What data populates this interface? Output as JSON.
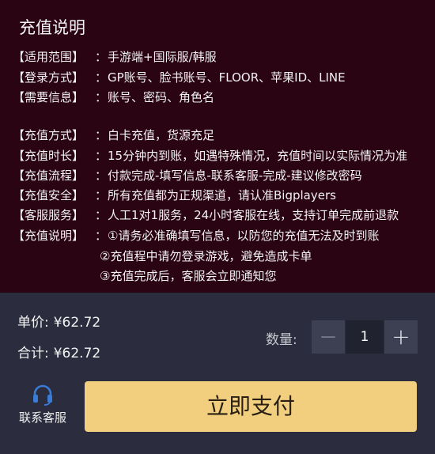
{
  "info": {
    "title": "充值说明",
    "rows": [
      {
        "label": "【适用范围】",
        "sep": "：",
        "value": "手游端+国际服/韩服"
      },
      {
        "label": "【登录方式】",
        "sep": "：",
        "value": "GP账号、脸书账号、FLOOR、苹果ID、LINE"
      },
      {
        "label": "【需要信息】",
        "sep": "：",
        "value": "账号、密码、角色名"
      },
      {
        "label": "【充值方式】",
        "sep": "：",
        "value": "白卡充值，货源充足"
      },
      {
        "label": "【充值时长】",
        "sep": "：",
        "value": "15分钟内到账，如遇特殊情况，充值时间以实际情况为准"
      },
      {
        "label": "【充值流程】",
        "sep": "：",
        "value": "付款完成-填写信息-联系客服-完成-建议修改密码"
      },
      {
        "label": "【充值安全】",
        "sep": "：",
        "value": "所有充值都为正规渠道，请认准Bigplayers"
      },
      {
        "label": "【客服服务】",
        "sep": "：",
        "value": "人工1对1服务，24小时客服在线，支持订单完成前退款"
      },
      {
        "label": "【充值说明】",
        "sep": "：",
        "value": "①请务必准确填写信息，以防您的充值无法及时到账"
      }
    ],
    "notes": [
      "②充值程中请勿登录游戏，避免造成卡单",
      "③充值完成后，客服会立即通知您"
    ]
  },
  "order": {
    "unit_price_label": "单价:",
    "unit_price": "¥62.72",
    "total_label": "合计:",
    "total": "¥62.72"
  },
  "quantity": {
    "label": "数量:",
    "value": "1",
    "minus": "−",
    "plus": "+"
  },
  "service": {
    "label": "联系客服",
    "icon": "headset-icon"
  },
  "pay_button": {
    "label": "立即支付",
    "color": "#f2cf7e"
  },
  "colors": {
    "info_bg": "#2a0412",
    "bottom_bg": "#2b2d3e",
    "accent_blue": "#3a7bd5"
  }
}
